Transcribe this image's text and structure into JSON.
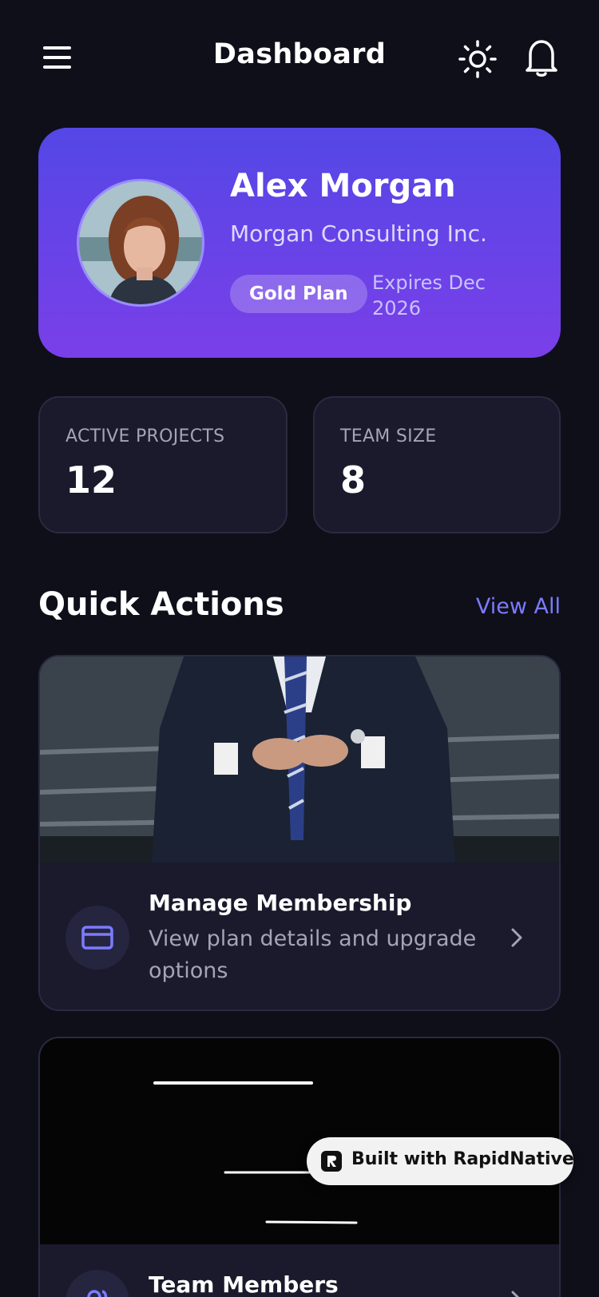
{
  "header": {
    "title": "Dashboard",
    "menu_icon": "hamburger-menu-icon",
    "theme_icon": "sun-icon",
    "notification_icon": "bell-icon"
  },
  "profile": {
    "name": "Alex Morgan",
    "company": "Morgan Consulting Inc.",
    "plan": "Gold Plan",
    "expiry": "Expires Dec 2026",
    "gradient": [
      "#5447e6",
      "#7a3fe8"
    ]
  },
  "stats": [
    {
      "label": "ACTIVE PROJECTS",
      "value": "12"
    },
    {
      "label": "TEAM SIZE",
      "value": "8"
    }
  ],
  "quick_actions": {
    "title": "Quick Actions",
    "view_all": "View All",
    "items": [
      {
        "title": "Manage Membership",
        "description": "View plan details and upgrade options",
        "icon": "credit-card-icon"
      },
      {
        "title": "Team Members",
        "description": "",
        "icon": "users-icon"
      }
    ]
  },
  "badge": {
    "text": "Built with RapidNative"
  },
  "colors": {
    "background": "#0f0f1a",
    "card": "#1a1a2c",
    "accent": "#7c7bff",
    "muted_text": "#a4a4b8"
  }
}
